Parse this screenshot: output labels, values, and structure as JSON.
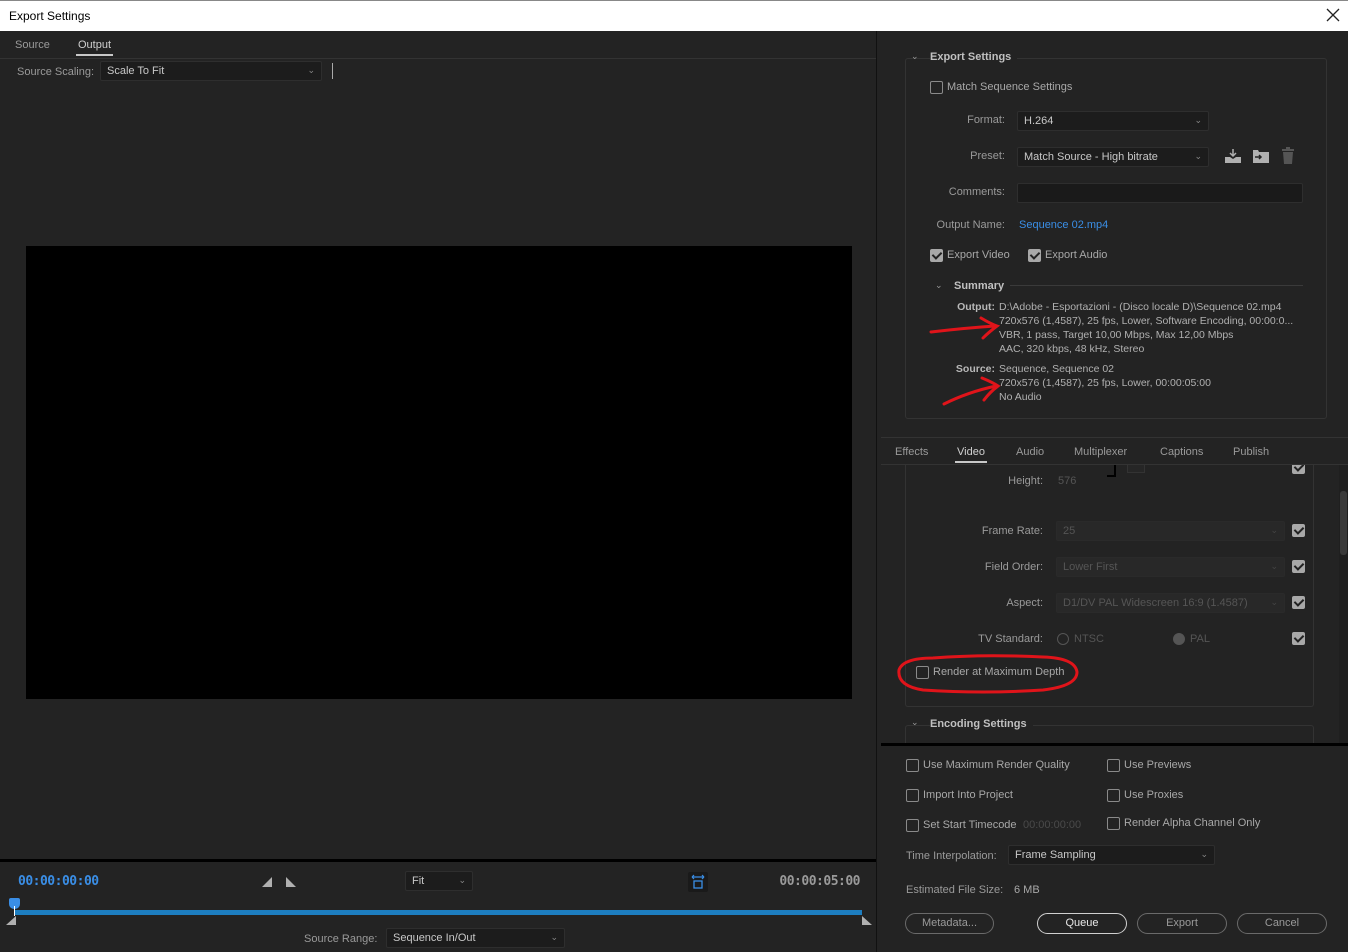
{
  "window": {
    "title": "Export Settings"
  },
  "left": {
    "tabs": [
      {
        "label": "Source"
      },
      {
        "label": "Output",
        "active": true
      }
    ],
    "source_scaling": {
      "label": "Source Scaling:",
      "value": "Scale To Fit"
    },
    "timeline": {
      "current_tc": "00:00:00:00",
      "end_tc": "00:00:05:00",
      "zoom": "Fit",
      "source_range_label": "Source Range:",
      "source_range_value": "Sequence In/Out",
      "accent": "#3a8ee6",
      "track_color": "#1d7ec0"
    }
  },
  "export_settings": {
    "header": "Export Settings",
    "match_sequence": {
      "label": "Match Sequence Settings",
      "checked": false
    },
    "format": {
      "label": "Format:",
      "value": "H.264"
    },
    "preset": {
      "label": "Preset:",
      "value": "Match Source - High bitrate"
    },
    "preset_icons": [
      "save-preset-icon",
      "import-preset-icon",
      "delete-preset-icon"
    ],
    "comments": {
      "label": "Comments:",
      "value": ""
    },
    "output_name": {
      "label": "Output Name:",
      "value": "Sequence 02.mp4"
    },
    "export_video": {
      "label": "Export Video",
      "checked": true
    },
    "export_audio": {
      "label": "Export Audio",
      "checked": true
    },
    "summary": {
      "header": "Summary",
      "output_key": "Output:",
      "output_lines": [
        "D:\\Adobe - Esportazioni - (Disco locale D)\\Sequence 02.mp4",
        "720x576 (1,4587), 25 fps, Lower, Software Encoding, 00:00:0...",
        "VBR, 1 pass, Target 10,00 Mbps, Max 12,00 Mbps",
        "AAC, 320 kbps, 48 kHz, Stereo"
      ],
      "source_key": "Source:",
      "source_lines": [
        "Sequence, Sequence 02",
        "720x576 (1,4587), 25 fps, Lower, 00:00:05:00",
        "No Audio"
      ]
    }
  },
  "settings_tabs": [
    {
      "label": "Effects"
    },
    {
      "label": "Video",
      "active": true
    },
    {
      "label": "Audio"
    },
    {
      "label": "Multiplexer"
    },
    {
      "label": "Captions"
    },
    {
      "label": "Publish"
    }
  ],
  "video": {
    "height": {
      "label": "Height:",
      "value": "576"
    },
    "frame_rate": {
      "label": "Frame Rate:",
      "value": "25"
    },
    "field_order": {
      "label": "Field Order:",
      "value": "Lower First"
    },
    "aspect": {
      "label": "Aspect:",
      "value": "D1/DV PAL Widescreen 16:9 (1.4587)"
    },
    "tv_standard": {
      "label": "TV Standard:",
      "options": [
        "NTSC",
        "PAL"
      ],
      "selected": "PAL"
    },
    "render_max_depth": {
      "label": "Render at Maximum Depth",
      "checked": false
    },
    "encoding_header": "Encoding Settings"
  },
  "bottom": {
    "use_max_render_quality": {
      "label": "Use Maximum Render Quality",
      "checked": false
    },
    "use_previews": {
      "label": "Use Previews",
      "checked": false
    },
    "import_into_project": {
      "label": "Import Into Project",
      "checked": false
    },
    "use_proxies": {
      "label": "Use Proxies",
      "checked": false
    },
    "set_start_timecode": {
      "label": "Set Start Timecode",
      "checked": false,
      "value": "00:00:00:00"
    },
    "render_alpha_only": {
      "label": "Render Alpha Channel Only",
      "checked": false
    },
    "time_interpolation": {
      "label": "Time Interpolation:",
      "value": "Frame Sampling"
    },
    "estimated_size": {
      "label": "Estimated File Size:",
      "value": "6 MB"
    },
    "buttons": {
      "metadata": "Metadata...",
      "queue": "Queue",
      "export": "Export",
      "cancel": "Cancel"
    }
  },
  "annotation_color": "#e0141a"
}
